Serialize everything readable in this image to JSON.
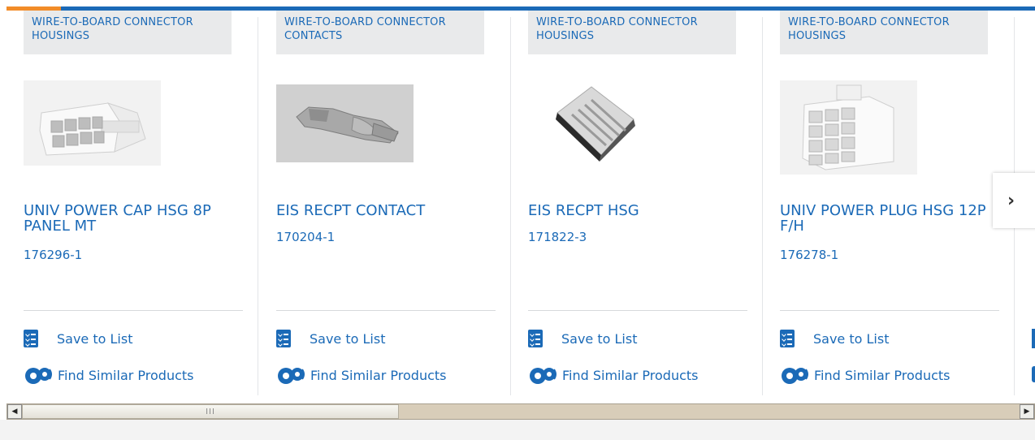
{
  "colors": {
    "brand_blue": "#1b6ab7",
    "accent_orange": "#f28c28",
    "tag_bg": "#e9eaeb"
  },
  "cards": [
    {
      "category": "WIRE-TO-BOARD CONNECTOR HOUSINGS",
      "name": "UNIV POWER CAP HSG 8P PANEL MT",
      "part_number": "176296-1",
      "save_label": "Save to List",
      "find_label": "Find Similar Products",
      "image_icon": "connector-housing-8p-image"
    },
    {
      "category": "WIRE-TO-BOARD CONNECTOR CONTACTS",
      "name": "EIS RECPT CONTACT",
      "part_number": "170204-1",
      "save_label": "Save to List",
      "find_label": "Find Similar Products",
      "image_icon": "contact-image"
    },
    {
      "category": "WIRE-TO-BOARD CONNECTOR HOUSINGS",
      "name": "EIS RECPT HSG",
      "part_number": "171822-3",
      "save_label": "Save to List",
      "find_label": "Find Similar Products",
      "image_icon": "recept-housing-image"
    },
    {
      "category": "WIRE-TO-BOARD CONNECTOR HOUSINGS",
      "name": "UNIV POWER PLUG HSG 12P F/H",
      "part_number": "176278-1",
      "save_label": "Save to List",
      "find_label": "Find Similar Products",
      "image_icon": "plug-housing-12p-image"
    }
  ],
  "next_button": {
    "glyph": "›",
    "icon": "chevron-right-icon"
  },
  "scrollbar": {
    "grip": "III",
    "left_arrow": "◀",
    "right_arrow": "▶"
  }
}
